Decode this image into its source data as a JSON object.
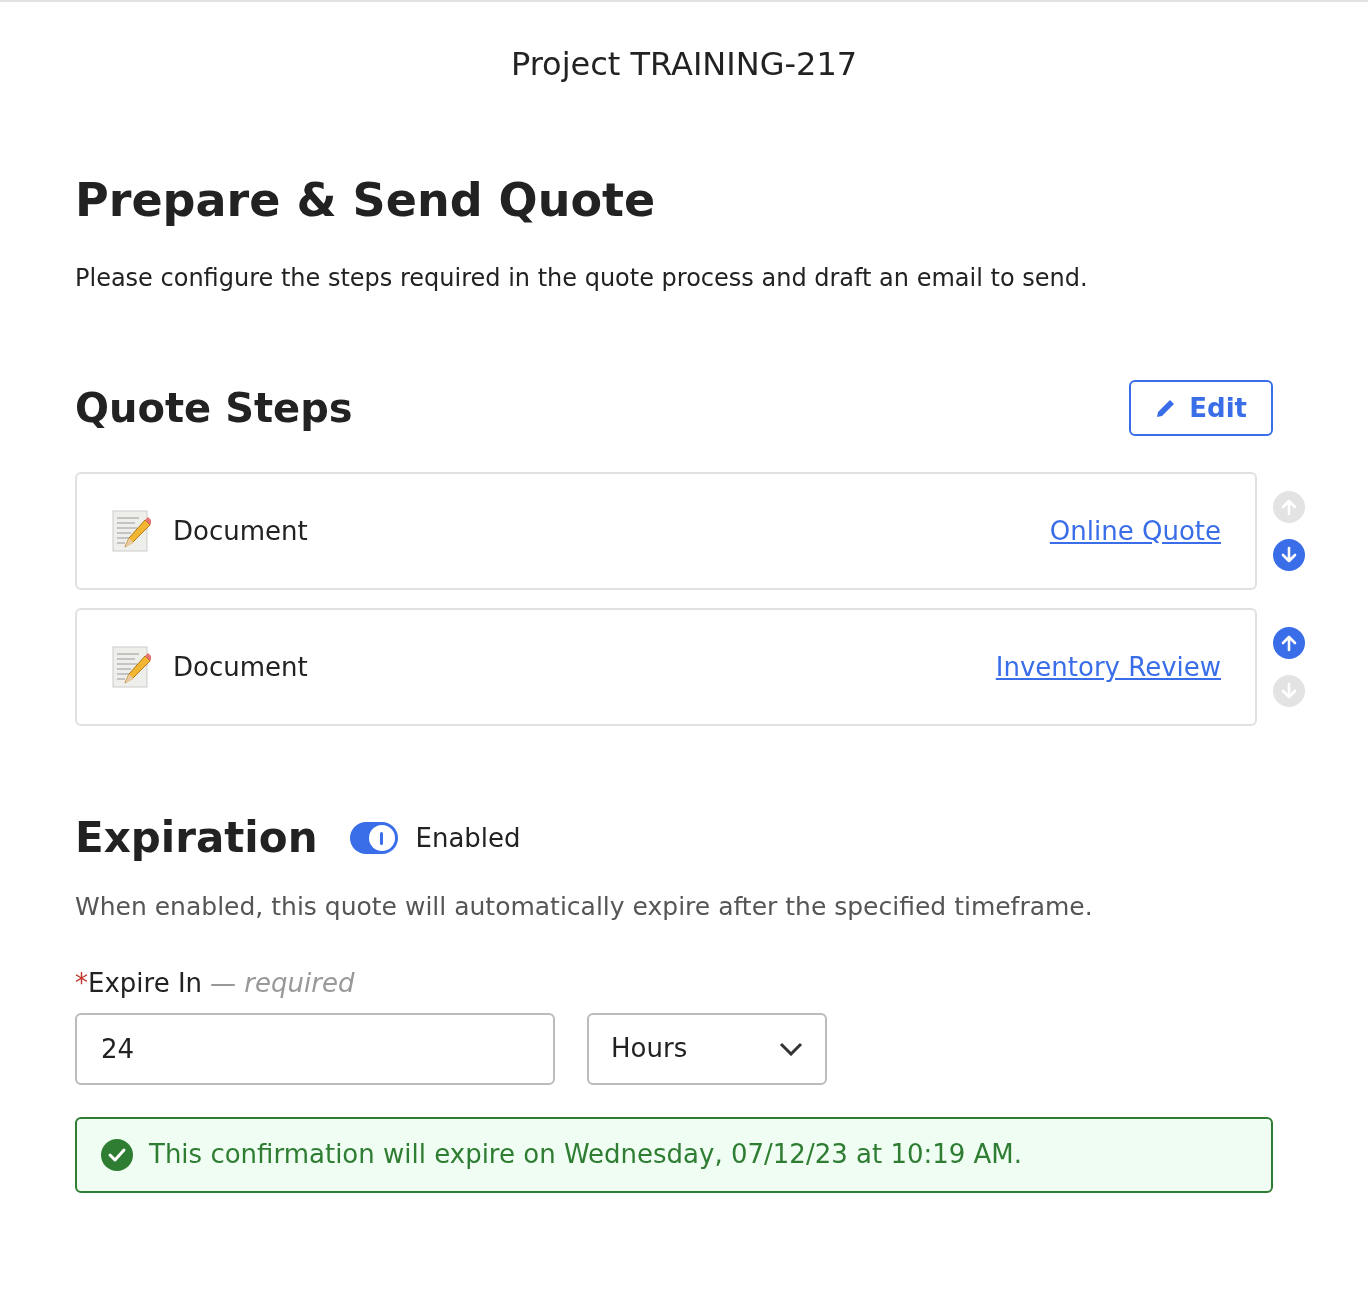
{
  "header": {
    "title": "Project TRAINING-217"
  },
  "page": {
    "title": "Prepare & Send Quote",
    "description": "Please configure the steps required in the quote process and draft an email to send."
  },
  "quote_steps": {
    "title": "Quote Steps",
    "edit_button": "Edit",
    "steps": [
      {
        "type": "Document",
        "link": "Online Quote",
        "move_up_disabled": true,
        "move_down_disabled": false
      },
      {
        "type": "Document",
        "link": "Inventory Review",
        "move_up_disabled": false,
        "move_down_disabled": true
      }
    ]
  },
  "expiration": {
    "title": "Expiration",
    "toggle": {
      "on": true,
      "label": "Enabled"
    },
    "description": "When enabled, this quote will automatically expire after the specified timeframe.",
    "field": {
      "required_mark": "*",
      "label": "Expire In",
      "hint": "— required",
      "value": "24"
    },
    "unit": {
      "value": "Hours"
    },
    "alert": "This confirmation will expire on Wednesday, 07/12/23 at 10:19 AM."
  }
}
